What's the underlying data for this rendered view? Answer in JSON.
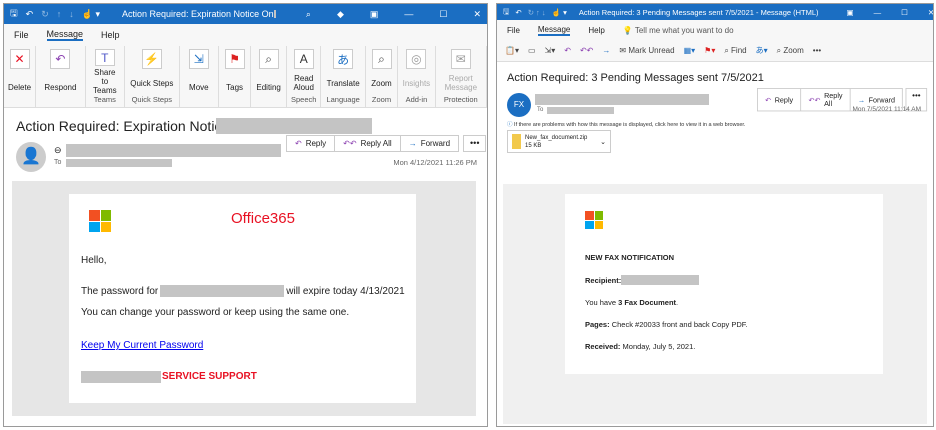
{
  "left": {
    "title": "Action Required: Expiration Notice On",
    "tabs": [
      "File",
      "Message",
      "Help"
    ],
    "ribbon": [
      {
        "icon": "delete-icon",
        "glyph": "✕",
        "label": "Delete",
        "group": ""
      },
      {
        "icon": "respond-icon",
        "glyph": "↶",
        "label": "Respond",
        "group": ""
      },
      {
        "icon": "teams-icon",
        "glyph": "T",
        "label": "Share to Teams",
        "group": "Teams"
      },
      {
        "icon": "lightning-icon",
        "glyph": "⚡",
        "label": "Quick Steps",
        "group": "Quick Steps"
      },
      {
        "icon": "move-icon",
        "glyph": "⇲",
        "label": "Move",
        "group": ""
      },
      {
        "icon": "flag-icon",
        "glyph": "⚑",
        "label": "Tags",
        "group": ""
      },
      {
        "icon": "search-icon",
        "glyph": "⌕",
        "label": "Editing",
        "group": ""
      },
      {
        "icon": "read-aloud-icon",
        "glyph": "A",
        "label": "Read Aloud",
        "group": "Speech"
      },
      {
        "icon": "translate-icon",
        "glyph": "あ",
        "label": "Translate",
        "group": "Language"
      },
      {
        "icon": "zoom-icon",
        "glyph": "⌕",
        "label": "Zoom",
        "group": "Zoom"
      },
      {
        "icon": "insights-icon",
        "glyph": "◎",
        "label": "Insights",
        "group": "Add-in"
      },
      {
        "icon": "report-icon",
        "glyph": "✉",
        "label": "Report Message",
        "group": "Protection"
      }
    ],
    "subject": "Action Required: Expiration Notice On",
    "to_label": "To",
    "actions": {
      "reply": "Reply",
      "reply_all": "Reply All",
      "forward": "Forward",
      "more": "•••"
    },
    "date": "Mon 4/12/2021 11:26 PM",
    "body": {
      "brand": "Office365",
      "greeting": "Hello,",
      "line1_a": "The password for",
      "line1_b": "will expire today 4/13/2021",
      "line2": "You can change  your password or keep using the same one.",
      "link": "Keep My Current Password",
      "signature": "SERVICE SUPPORT"
    }
  },
  "right": {
    "title": "Action Required: 3 Pending Messages sent 7/5/2021  -  Message (HTML)",
    "tabs": [
      "File",
      "Message",
      "Help"
    ],
    "tell_me": "Tell me what you want to do",
    "toolbar": {
      "mark_unread": "Mark Unread",
      "find": "Find",
      "zoom": "Zoom",
      "more": "•••"
    },
    "subject": "Action Required: 3 Pending Messages sent 7/5/2021",
    "avatar": "FX",
    "to_label": "To",
    "actions": {
      "reply": "Reply",
      "reply_all": "Reply All",
      "forward": "Forward",
      "more": "•••"
    },
    "date": "Mon 7/5/2021 11:14 AM",
    "info": "If there are problems with how this message is displayed, click here to view it in a web browser.",
    "attachment": {
      "name": "New_fax_document.zip",
      "size": "15 KB"
    },
    "body": {
      "heading": "NEW FAX NOTIFICATION",
      "recipient_label": "Recipient:",
      "have_a": "You have ",
      "have_b": "3 Fax Document",
      "have_c": ".",
      "pages_label": "Pages:",
      "pages_value": " Check #20033 front and back Copy PDF.",
      "received_label": "Received:",
      "received_value": " Monday, July 5, 2021."
    }
  },
  "colors": {
    "titlebar": "#1b6ec2",
    "alert_red": "#e81123",
    "link": "#0000ee"
  }
}
